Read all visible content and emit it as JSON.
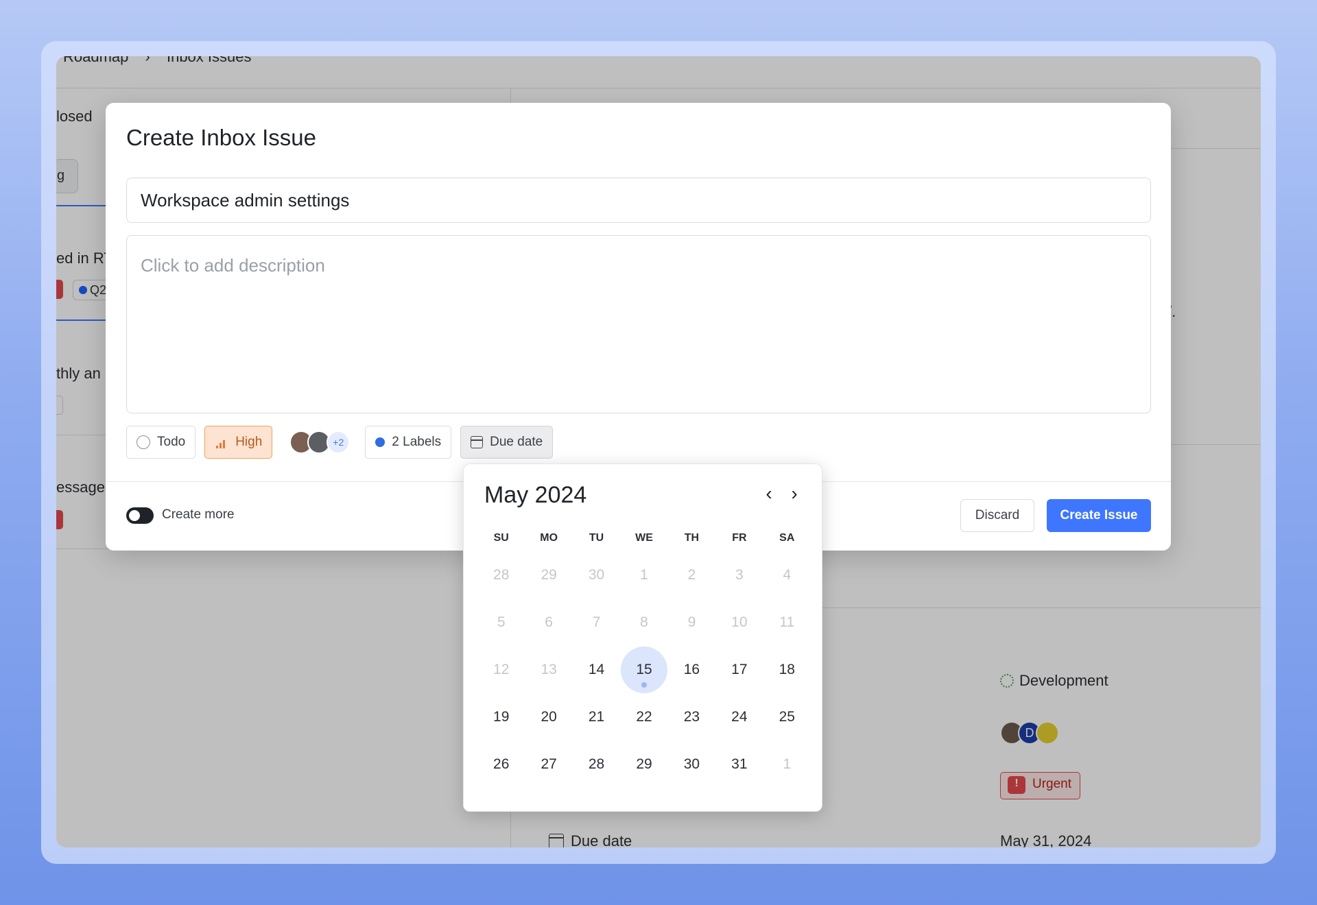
{
  "background": {
    "breadcrumb": [
      "Roadmap",
      "Inbox Issues"
    ],
    "tab_closed": "losed",
    "chip_fragment": "g",
    "row1_text": "ed in RT",
    "row1_label": "Q2",
    "row2_text": "thly an",
    "row3_text": "essage",
    "side_text_1": ".",
    "side_text_2": "/.",
    "properties": {
      "state": "Development",
      "assignee_initial": "D",
      "priority": "Urgent",
      "due_date_label": "Due date",
      "due_date_value": "May 31, 2024"
    }
  },
  "modal": {
    "title": "Create Inbox Issue",
    "issue_title_value": "Workspace admin settings",
    "description_placeholder": "Click to add description",
    "chips": {
      "state": "Todo",
      "priority": "High",
      "assignees_extra": "+2",
      "labels": "2 Labels",
      "due_date": "Due date"
    },
    "create_more": "Create more",
    "discard": "Discard",
    "create": "Create Issue"
  },
  "calendar": {
    "month_label": "May 2024",
    "weekdays": [
      "SU",
      "MO",
      "TU",
      "WE",
      "TH",
      "FR",
      "SA"
    ],
    "weeks": [
      [
        "28",
        "29",
        "30",
        "1",
        "2",
        "3",
        "4"
      ],
      [
        "5",
        "6",
        "7",
        "8",
        "9",
        "10",
        "11"
      ],
      [
        "12",
        "13",
        "14",
        "15",
        "16",
        "17",
        "18"
      ],
      [
        "19",
        "20",
        "21",
        "22",
        "23",
        "24",
        "25"
      ],
      [
        "26",
        "27",
        "28",
        "29",
        "30",
        "31",
        "1"
      ]
    ],
    "muted_until_index": 16,
    "today": "15",
    "colors": {
      "accent": "#3f76ff",
      "today_bg": "#dbe5fb",
      "priority_high": "#e5793a",
      "urgent": "#e5484d"
    }
  }
}
